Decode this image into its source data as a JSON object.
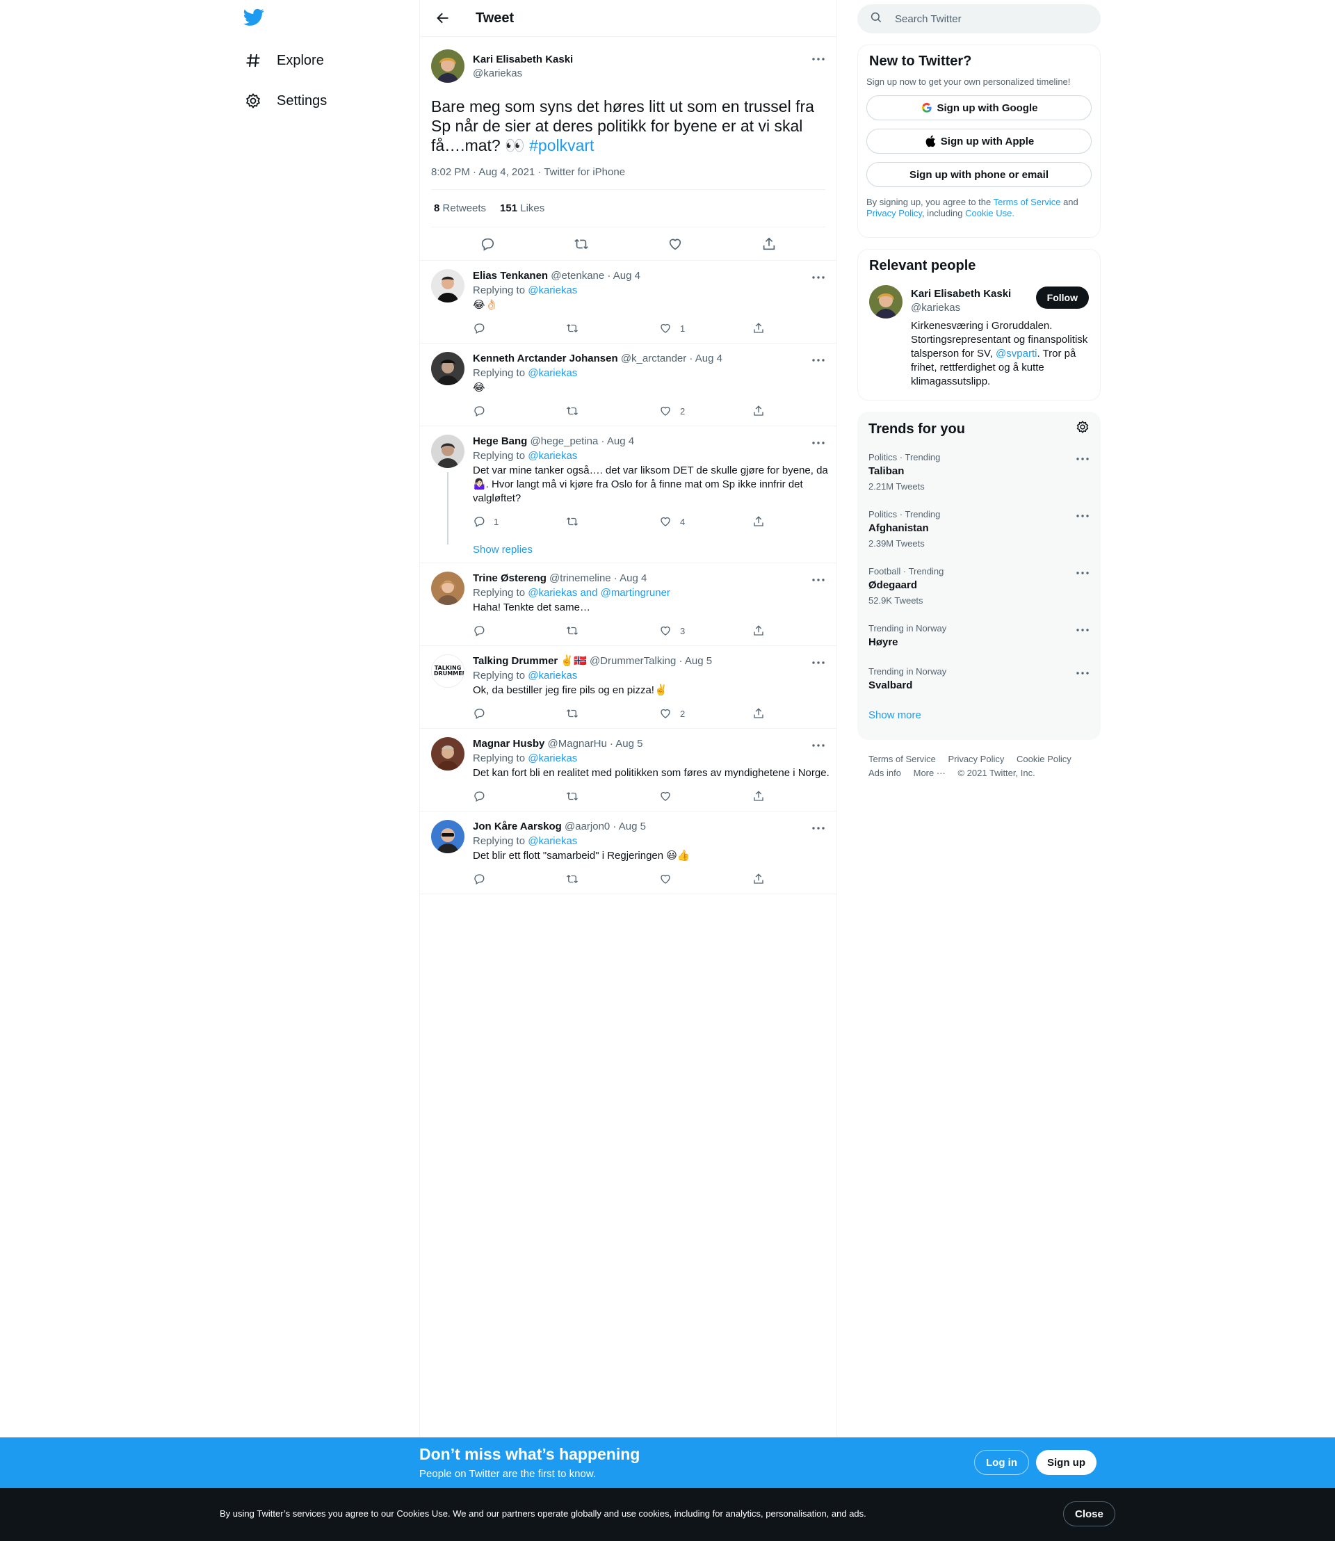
{
  "nav": {
    "logo": "twitter-bird-icon",
    "items": [
      {
        "label": "Explore",
        "icon": "hashtag-icon"
      },
      {
        "label": "Settings",
        "icon": "gear-icon"
      }
    ]
  },
  "header": {
    "title": "Tweet"
  },
  "main_tweet": {
    "name": "Kari Elisabeth Kaski",
    "handle": "@kariekas",
    "text": "Bare meg som syns det høres litt ut som en trussel fra Sp når de sier at deres politikk for byene er at vi skal få….mat? 👀",
    "hashtag": "#polkvart",
    "meta": "8:02 PM · Aug 4, 2021 · Twitter for iPhone",
    "retweets_count": "8",
    "retweets_label": "Retweets",
    "likes_count": "151",
    "likes_label": "Likes"
  },
  "replies": [
    {
      "name": "Elias Tenkanen",
      "handle_date": "@etenkane · Aug 4",
      "replying_prefix": "Replying to",
      "replying_to": "@kariekas",
      "text": "😂👌🏻",
      "reply_count": "",
      "retweet_count": "",
      "like_count": "1"
    },
    {
      "name": "Kenneth Arctander Johansen",
      "handle_date": "@k_arctander · Aug 4",
      "replying_prefix": "Replying to",
      "replying_to": "@kariekas",
      "text": "😂",
      "reply_count": "",
      "retweet_count": "",
      "like_count": "2"
    },
    {
      "name": "Hege Bang",
      "handle_date": "@hege_petina · Aug 4",
      "replying_prefix": "Replying to",
      "replying_to": "@kariekas",
      "text": "Det var mine tanker også…. det var liksom DET de skulle gjøre for byene, da 🤷🏻‍♀️. Hvor langt må vi kjøre fra Oslo for å finne mat om Sp ikke innfrir det valgløftet?",
      "reply_count": "1",
      "retweet_count": "",
      "like_count": "4",
      "show_replies": "Show replies"
    },
    {
      "name": "Trine Østereng",
      "handle_date": "@trinemeline · Aug 4",
      "replying_prefix": "Replying to",
      "replying_to": "@kariekas and @martingruner",
      "text": "Haha! Tenkte det same…",
      "reply_count": "",
      "retweet_count": "",
      "like_count": "3"
    },
    {
      "name": "Talking Drummer ✌️🇳🇴",
      "handle_date": "@DrummerTalking · Aug 5",
      "replying_prefix": "Replying to",
      "replying_to": "@kariekas",
      "text": "Ok, da bestiller jeg fire pils og en pizza!✌️",
      "reply_count": "",
      "retweet_count": "",
      "like_count": "2",
      "avatar_text": "TALKING DRUMMER"
    },
    {
      "name": "Magnar Husby",
      "handle_date": "@MagnarHu · Aug 5",
      "replying_prefix": "Replying to",
      "replying_to": "@kariekas",
      "text": "Det kan fort bli en realitet med politikken som føres av myndighetene i Norge.",
      "reply_count": "",
      "retweet_count": "",
      "like_count": ""
    },
    {
      "name": "Jon Kåre Aarskog",
      "handle_date": "@aarjon0 · Aug 5",
      "replying_prefix": "Replying to",
      "replying_to": "@kariekas",
      "text": "Det blir ett flott \"samarbeid\" i Regjeringen 😃👍",
      "reply_count": "",
      "retweet_count": "",
      "like_count": ""
    }
  ],
  "search": {
    "placeholder": "Search Twitter"
  },
  "new_to_twitter": {
    "title": "New to Twitter?",
    "subtitle": "Sign up now to get your own personalized timeline!",
    "google_btn": "Sign up with Google",
    "apple_btn": "Sign up with Apple",
    "phone_btn": "Sign up with phone or email",
    "legal_prefix": "By signing up, you agree to the",
    "terms": "Terms of Service",
    "and": "and",
    "privacy": "Privacy Policy",
    "including": ", including",
    "cookie": "Cookie Use."
  },
  "relevant_people": {
    "title": "Relevant people",
    "name": "Kari Elisabeth Kaski",
    "handle": "@kariekas",
    "follow": "Follow",
    "bio_part1": "Kirkenesværing i Groruddalen. Stortingsrepresentant og finanspolitisk talsperson for SV,",
    "bio_link": "@svparti",
    "bio_part2": ". Tror på frihet, rettferdighet og å kutte klimagassutslipp."
  },
  "trends": {
    "title": "Trends for you",
    "items": [
      {
        "category": "Politics · Trending",
        "name": "Taliban",
        "count": "2.21M Tweets"
      },
      {
        "category": "Politics · Trending",
        "name": "Afghanistan",
        "count": "2.39M Tweets"
      },
      {
        "category": "Football · Trending",
        "name": "Ødegaard",
        "count": "52.9K Tweets"
      },
      {
        "category": "Trending in Norway",
        "name": "Høyre",
        "count": ""
      },
      {
        "category": "Trending in Norway",
        "name": "Svalbard",
        "count": ""
      }
    ],
    "show_more": "Show more"
  },
  "footer": {
    "terms": "Terms of Service",
    "privacy": "Privacy Policy",
    "cookie": "Cookie Policy",
    "ads": "Ads info",
    "more": "More ···",
    "copyright": "© 2021 Twitter, Inc."
  },
  "signup_bar": {
    "title": "Don’t miss what’s happening",
    "subtitle": "People on Twitter are the first to know.",
    "login": "Log in",
    "signup": "Sign up"
  },
  "cookie_bar": {
    "text": "By using Twitter’s services you agree to our Cookies Use. We and our partners operate globally and use cookies, including for analytics, personalisation, and ads.",
    "close": "Close"
  },
  "colors": {
    "accent": "#1d9bf0",
    "text": "#0f1419",
    "secondary": "#536471",
    "dark_bar": "#0f1419"
  }
}
